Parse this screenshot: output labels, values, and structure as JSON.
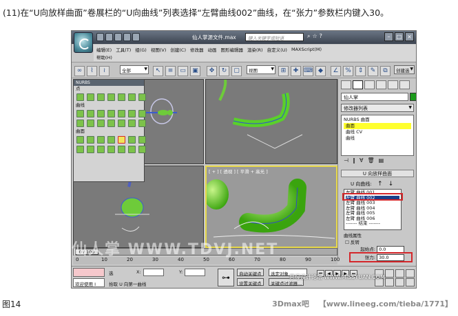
{
  "caption": "(11)在“U向放样曲面”卷展栏的“U向曲线”列表选择“左臂曲线002”曲线，在“张力”参数栏内键入30。",
  "figure_label": "图14",
  "credit": {
    "left": "3Dmax吧",
    "right": "【www.lineeg.com/tieba/1771】"
  },
  "window": {
    "title": "仙人掌源文件.max",
    "search_placeholder": "键入关键字或短语"
  },
  "menus": [
    "编辑(E)",
    "工具(T)",
    "组(G)",
    "视图(V)",
    "创建(C)",
    "修改器",
    "动画",
    "图形编辑器",
    "渲染(R)",
    "自定义(U)",
    "MAXScript(M)"
  ],
  "menu_help": "帮助(H)",
  "toolbar": {
    "selection_filter": "全部",
    "ref_coord": "视图",
    "right_label": "创建选"
  },
  "nurbs_panel": {
    "title": "NURBS",
    "section_points": "点",
    "section_curves": "曲线",
    "section_surfaces": "曲面"
  },
  "viewports": {
    "perspective_label": "[ + ] [ 透视 ] [ 平滑 + 高光 ]"
  },
  "command_panel": {
    "object_name": "仙人掌",
    "color": "#1a9a1a",
    "modifier_list": "修改器列表",
    "stack": [
      "NURBS 曲面",
      "曲面",
      "曲线 CV",
      "曲线"
    ],
    "stack_selected": 1,
    "rollout_title": "U 向放样曲面",
    "u_curves_label": "U 向曲线:",
    "curves": [
      "左臂 曲线 001",
      "左臂 曲线 002",
      "左臂 曲线 003",
      "左臂 曲线 004",
      "左臂 曲线 005",
      "左臂 曲线 006"
    ],
    "curves_selected": 1,
    "list_end": "------- 结束 -------",
    "curve_props_label": "曲线属性",
    "reverse_label": "反转",
    "start_label": "起始点:",
    "start_value": "0.0",
    "tension_label": "张力:",
    "tension_value": "30.0"
  },
  "timeline": {
    "slider": "0 / 100",
    "ticks": [
      "0",
      "10",
      "20",
      "30",
      "40",
      "50",
      "60",
      "70",
      "80",
      "90",
      "100"
    ]
  },
  "status": {
    "welcome": "欢迎使用 I",
    "selected": "选",
    "x_label": "X:",
    "y_label": "Y:",
    "prompt": "拾取 U 向第一曲线",
    "auto_key": "自动关键点",
    "set_key": "设置关键点",
    "selected_object": "选定对象",
    "key_filter": "关键点过滤器..."
  },
  "watermark": "思缘设计论坛 WWW.MISSYUAN.COM",
  "watermark_big": "仙人掌  WWW.TDVJ.NET"
}
